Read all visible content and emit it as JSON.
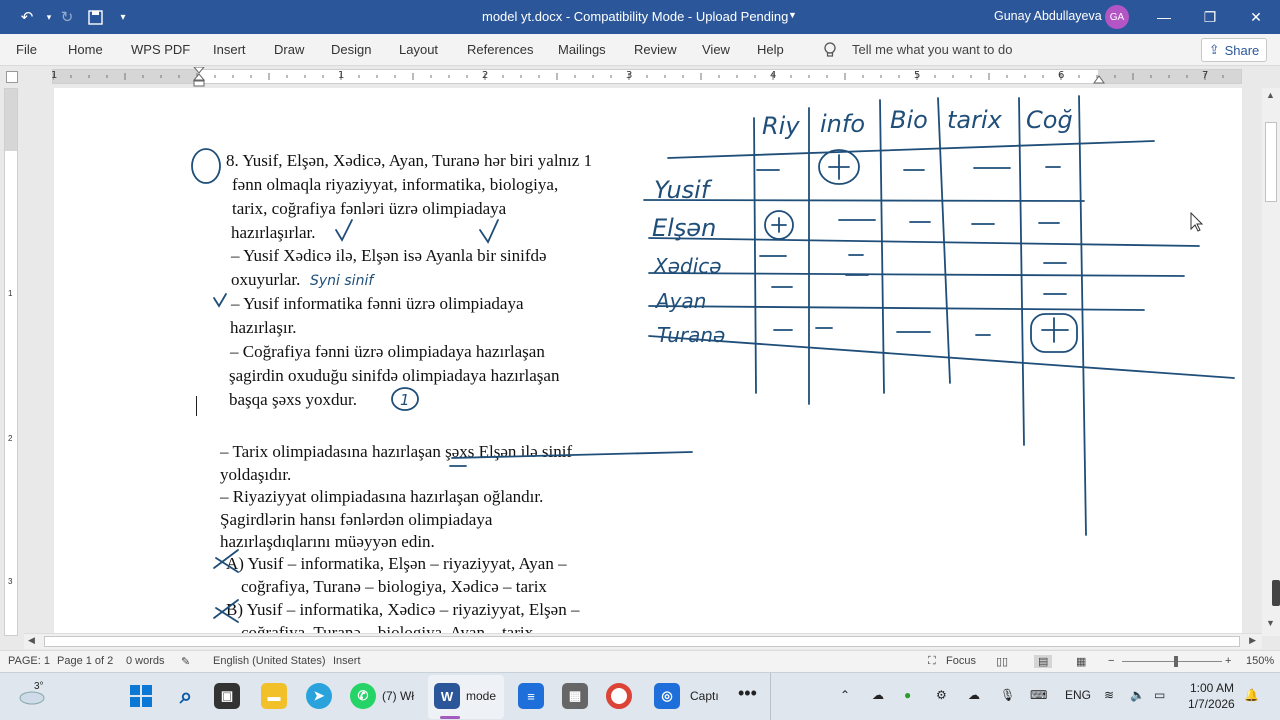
{
  "titlebar": {
    "title": "model yt.docx  -  Compatibility Mode  -  Upload Pending",
    "user_name": "Gunay Abdullayeva",
    "user_initials": "GA"
  },
  "ribbon": {
    "tabs": [
      "File",
      "Home",
      "WPS PDF",
      "Insert",
      "Draw",
      "Design",
      "Layout",
      "References",
      "Mailings",
      "Review",
      "View",
      "Help"
    ],
    "tell_me": "Tell me what you want to do",
    "share": "Share"
  },
  "ruler": {
    "numbers": [
      "1",
      "1",
      "2",
      "3",
      "4",
      "5",
      "6",
      "7"
    ],
    "vnumbers": [
      "1",
      "2",
      "3"
    ]
  },
  "document": {
    "question_lines": [
      "8. Yusif, Elşən, Xədicə, Ayan, Turanə hər biri yalnız 1",
      "fənn olmaqla riyaziyyat, informatika, biologiya,",
      "tarix, coğrafiya fənləri üzrə olimpiadaya",
      "hazırlaşırlar.",
      "– Yusif Xədicə ilə, Elşən isə Ayanla bir sinifdə",
      "oxuyurlar.",
      "– Yusif informatika fənni üzrə olimpiadaya",
      "hazırlaşır.",
      "– Coğrafiya fənni üzrə olimpiadaya hazırlaşan",
      "şagirdin oxuduğu sinifdə olimpiadaya hazırlaşan",
      "başqa şəxs yoxdur."
    ],
    "continued_lines": [
      "– Tarix olimpiadasına hazırlaşan şəxs Elşən ilə sinif",
      "yoldaşıdır.",
      "– Riyaziyyat olimpiadasına hazırlaşan oğlandır.",
      "Şagirdlərin hansı fənlərdən olimpiadaya",
      "hazırlaşdıqlarını müəyyən edin.",
      "A) Yusif – informatika, Elşən – riyaziyyat, Ayan –",
      "coğrafiya, Turanə – biologiya, Xədicə – tarix",
      "B) Yusif – informatika, Xədicə – riyaziyyat, Elşən –",
      "coğrafiya, Turanə – biologiya, Ayan – tarix"
    ],
    "handwriting": {
      "columns": [
        "Riy",
        "info",
        "Bio",
        "tarix",
        "Coğ"
      ],
      "rows": [
        "Yusif",
        "Elşən",
        "Xədicə",
        "Ayan",
        "Turanə"
      ],
      "note_same_class": "Syni sinif",
      "circled_number": "1"
    }
  },
  "statusbar": {
    "page": "PAGE: 1",
    "page_of": "Page 1 of 2",
    "words": "0 words",
    "language": "English (United States)",
    "mode": "Insert",
    "focus": "Focus",
    "zoom": "150%"
  },
  "taskbar": {
    "weather": "3°",
    "whatsapp": "(7) Wł",
    "word": "mode",
    "capture": "Captı",
    "lang": "ENG",
    "time": "1:00 AM",
    "date": "1/7/2026"
  },
  "colors": {
    "word_blue": "#2b579a",
    "ink": "#1f4e79"
  }
}
